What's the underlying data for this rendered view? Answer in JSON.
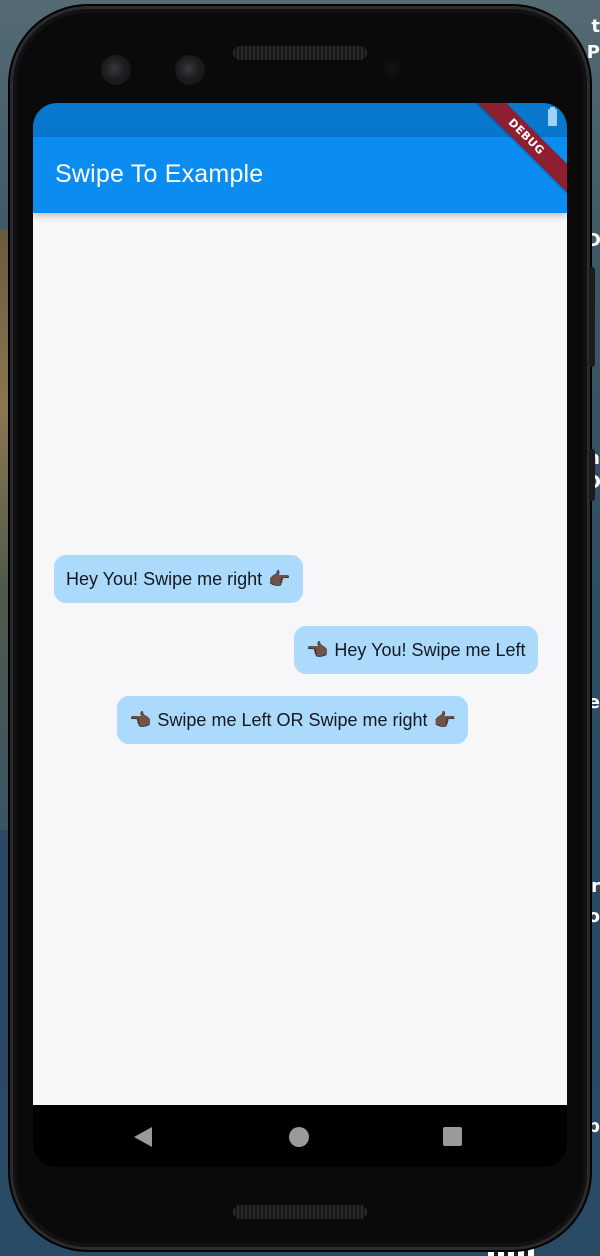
{
  "app": {
    "title": "Swipe To Example",
    "debug_banner": "DEBUG",
    "accent_color": "#0a8cf1",
    "status_bar_color": "#0877ce",
    "bubble_color": "#acdafd"
  },
  "messages": [
    {
      "text": "Hey You! Swipe me right",
      "leading_icon": null,
      "trailing_icon": "pointing-right-hand-icon",
      "trailing_glyph": "👉🏿"
    },
    {
      "text": "Hey You! Swipe me Left",
      "leading_icon": "pointing-left-hand-icon",
      "leading_glyph": "👈🏿",
      "trailing_icon": null
    },
    {
      "text": "Swipe me Left OR Swipe me right",
      "leading_icon": "pointing-left-hand-icon",
      "leading_glyph": "👈🏿",
      "trailing_icon": "pointing-right-hand-icon",
      "trailing_glyph": "👉🏿"
    }
  ],
  "navigation": {
    "back_icon": "back-icon",
    "home_icon": "home-icon",
    "recents_icon": "recents-icon"
  },
  "status_bar": {
    "battery_icon": "battery-icon"
  }
}
